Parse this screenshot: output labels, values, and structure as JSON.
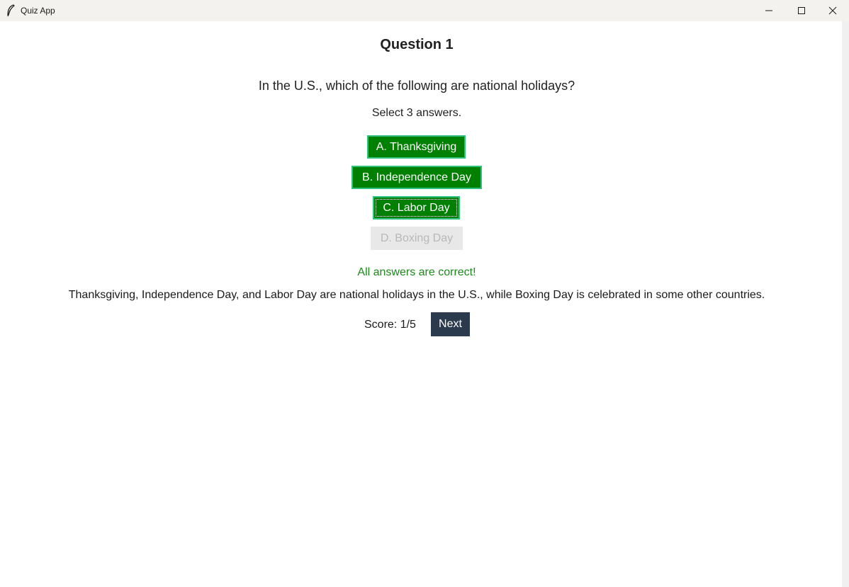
{
  "window": {
    "title": "Quiz App",
    "icon": "feather-icon",
    "controls": [
      "minimize-icon",
      "maximize-icon",
      "close-icon"
    ]
  },
  "question": {
    "title": "Question 1",
    "text": "In the U.S., which of the following are national holidays?",
    "hint": "Select 3 answers."
  },
  "options": [
    {
      "label": "A. Thanksgiving",
      "state": "selected-correct"
    },
    {
      "label": "B. Independence Day",
      "state": "selected-correct"
    },
    {
      "label": "C. Labor Day",
      "state": "selected-correct"
    },
    {
      "label": "D. Boxing Day",
      "state": "disabled"
    }
  ],
  "feedback": "All answers are correct!",
  "explanation": "Thanksgiving, Independence Day, and Labor Day are national holidays in the U.S., while Boxing Day is celebrated in some other countries.",
  "score": {
    "label": "Score: 1/5"
  },
  "next_label": "Next",
  "colors": {
    "correct": "#008000",
    "correct_border": "#2ec27e",
    "feedback_text": "#1a8a1a",
    "disabled_bg": "#e8e8e8",
    "disabled_text": "#b8b8b8",
    "next_bg": "#2c3a4e",
    "titlebar_bg": "#f3f2ee"
  }
}
